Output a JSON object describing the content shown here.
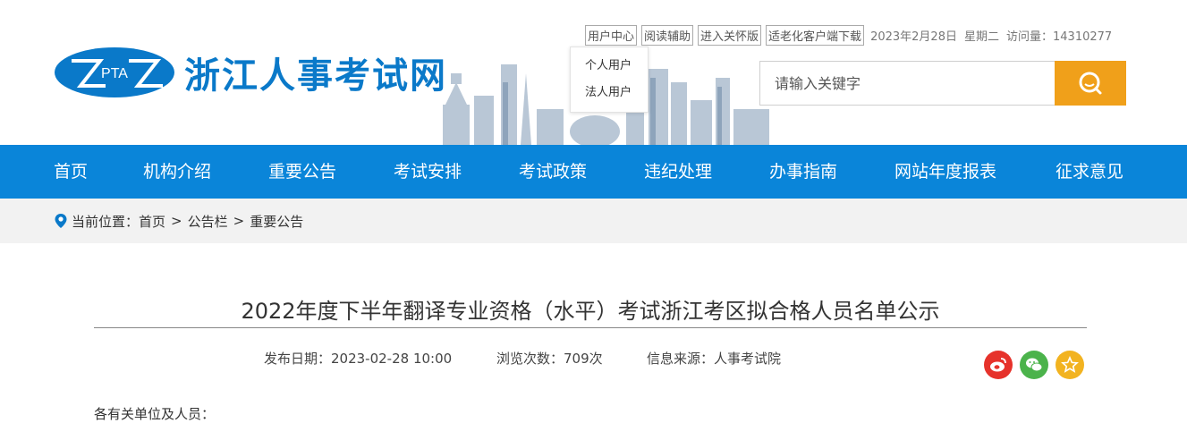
{
  "site": {
    "logo_mark": "PTA",
    "name": "浙江人事考试网"
  },
  "toplinks": {
    "items": [
      "用户中心",
      "阅读辅助",
      "进入关怀版",
      "适老化客户端下载"
    ],
    "date": "2023年2月28日",
    "weekday": "星期二",
    "visits_label": "访问量：",
    "visits_value": "14310277"
  },
  "user_dropdown": {
    "items": [
      "个人用户",
      "法人用户"
    ]
  },
  "search": {
    "placeholder": "请输入关键字",
    "accent": "#f0a01a"
  },
  "nav": {
    "color": "#0a85d9",
    "items": [
      "首页",
      "机构介绍",
      "重要公告",
      "考试安排",
      "考试政策",
      "违纪处理",
      "办事指南",
      "网站年度报表",
      "征求意见"
    ]
  },
  "breadcrumb": {
    "prefix": "当前位置：",
    "items": [
      "首页",
      "公告栏",
      "重要公告"
    ],
    "separator": ">"
  },
  "article": {
    "title": "2022年度下半年翻译专业资格（水平）考试浙江考区拟合格人员名单公示",
    "publish_date": "发布日期：2023-02-28 10:00",
    "views": "浏览次数：709次",
    "source": "信息来源：人事考试院",
    "body_start": "各有关单位及人员："
  },
  "share": {
    "icons": [
      "weibo-icon",
      "wechat-icon",
      "favorite-icon"
    ]
  }
}
